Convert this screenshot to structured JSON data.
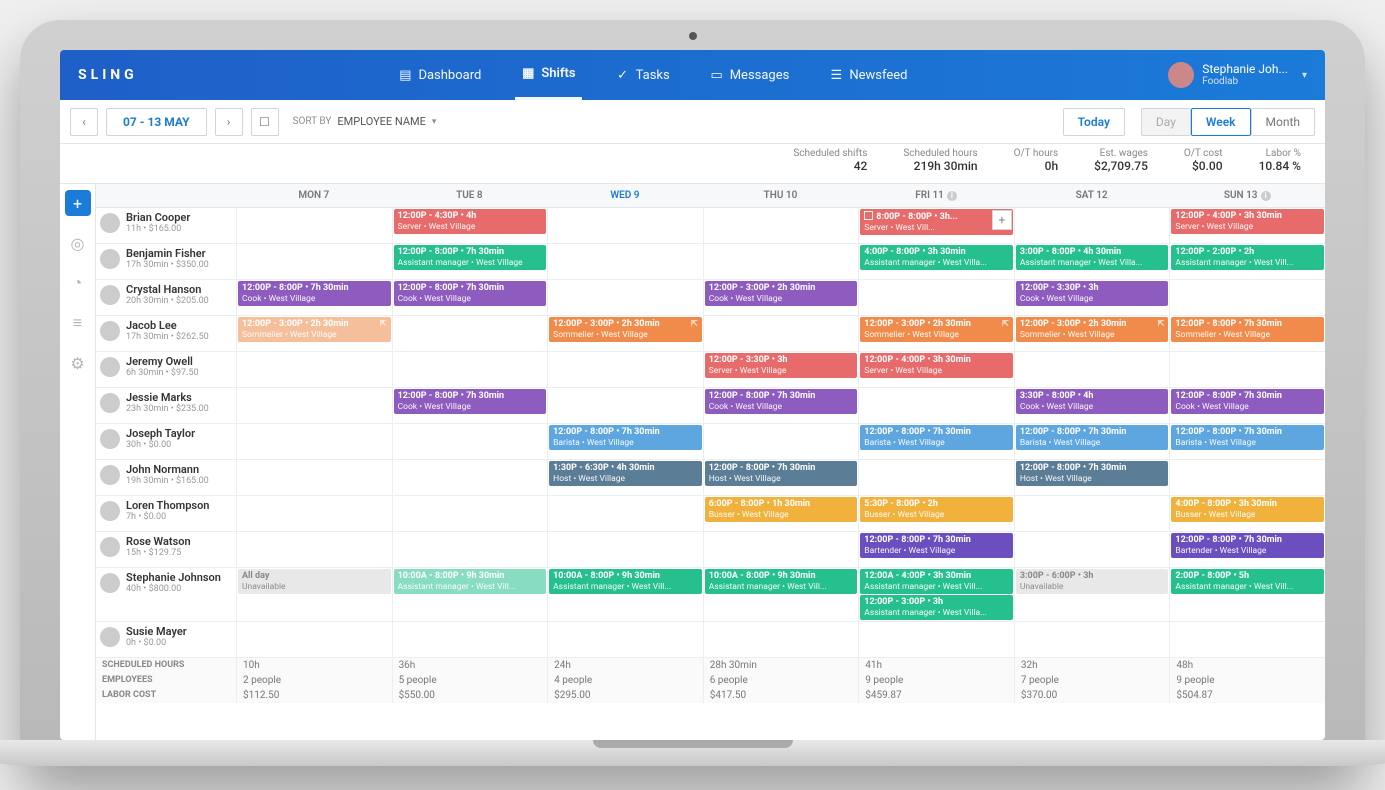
{
  "brand": "SLING",
  "nav": [
    {
      "label": "Dashboard",
      "icon": "dashboard"
    },
    {
      "label": "Shifts",
      "icon": "shifts",
      "active": true
    },
    {
      "label": "Tasks",
      "icon": "tasks"
    },
    {
      "label": "Messages",
      "icon": "messages"
    },
    {
      "label": "Newsfeed",
      "icon": "newsfeed"
    }
  ],
  "user": {
    "name": "Stephanie Joh...",
    "company": "Foodlab"
  },
  "toolbar": {
    "prev": "‹",
    "next": "›",
    "date_range": "07 - 13 MAY",
    "sort_label": "SORT BY",
    "sort_value": "EMPLOYEE NAME",
    "today": "Today",
    "views": [
      {
        "label": "Day",
        "state": "disabled"
      },
      {
        "label": "Week",
        "state": "active"
      },
      {
        "label": "Month",
        "state": ""
      }
    ]
  },
  "stats": [
    {
      "label": "Scheduled shifts",
      "value": "42"
    },
    {
      "label": "Scheduled hours",
      "value": "219h 30min"
    },
    {
      "label": "O/T hours",
      "value": "0h"
    },
    {
      "label": "Est. wages",
      "value": "$2,709.75"
    },
    {
      "label": "O/T cost",
      "value": "$0.00"
    },
    {
      "label": "Labor %",
      "value": "10.84 %"
    }
  ],
  "days": [
    {
      "label": "MON 7"
    },
    {
      "label": "TUE 8"
    },
    {
      "label": "WED 9",
      "active": true
    },
    {
      "label": "THU 10"
    },
    {
      "label": "FRI 11",
      "info": true
    },
    {
      "label": "SAT 12"
    },
    {
      "label": "SUN 13",
      "info": true
    }
  ],
  "colors": {
    "Server": "c-server",
    "Assistant manager": "c-am",
    "Cook": "c-cook",
    "Sommelier": "c-somm",
    "Barista": "c-barista",
    "Host": "c-host",
    "Busser": "c-busser",
    "Bartender": "c-bartender"
  },
  "employees": [
    {
      "name": "Brian Cooper",
      "meta": "11h • $165.00",
      "shifts": {
        "1": [
          {
            "time": "12:00P - 4:30P • 4h",
            "role": "Server",
            "loc": "West Village"
          }
        ],
        "4": [
          {
            "time": "8:00P - 8:00P • 3h...",
            "role": "Server",
            "loc": "West Vill...",
            "chk": true,
            "addplus": true
          }
        ],
        "6": [
          {
            "time": "12:00P - 4:00P • 3h 30min",
            "role": "Server",
            "loc": "West Village"
          }
        ]
      }
    },
    {
      "name": "Benjamin Fisher",
      "meta": "17h 30min • $350.00",
      "shifts": {
        "1": [
          {
            "time": "12:00P - 8:00P • 7h 30min",
            "role": "Assistant manager",
            "loc": "West Village"
          }
        ],
        "4": [
          {
            "time": "4:00P - 8:00P • 3h 30min",
            "role": "Assistant manager",
            "loc": "West Villa..."
          }
        ],
        "5": [
          {
            "time": "3:00P - 8:00P • 4h 30min",
            "role": "Assistant manager",
            "loc": "West Villa..."
          }
        ],
        "6": [
          {
            "time": "12:00P - 2:00P • 2h",
            "role": "Assistant manager",
            "loc": "West Vill..."
          }
        ]
      }
    },
    {
      "name": "Crystal Hanson",
      "meta": "20h 30min • $205.00",
      "shifts": {
        "0": [
          {
            "time": "12:00P - 8:00P • 7h 30min",
            "role": "Cook",
            "loc": "West Village"
          }
        ],
        "1": [
          {
            "time": "12:00P - 8:00P • 7h 30min",
            "role": "Cook",
            "loc": "West Village"
          }
        ],
        "3": [
          {
            "time": "12:00P - 3:00P • 2h 30min",
            "role": "Cook",
            "loc": "West Village"
          }
        ],
        "5": [
          {
            "time": "12:00P - 3:30P • 3h",
            "role": "Cook",
            "loc": "West Village"
          }
        ]
      }
    },
    {
      "name": "Jacob Lee",
      "meta": "17h 30min • $262.50",
      "shifts": {
        "0": [
          {
            "time": "12:00P - 3:00P • 2h 30min",
            "role": "Sommelier",
            "loc": "West Village",
            "faded": true,
            "ext": true
          }
        ],
        "2": [
          {
            "time": "12:00P - 3:00P • 2h 30min",
            "role": "Sommelier",
            "loc": "West Village",
            "ext": true
          }
        ],
        "4": [
          {
            "time": "12:00P - 3:00P • 2h 30min",
            "role": "Sommelier",
            "loc": "West Village",
            "ext": true
          }
        ],
        "5": [
          {
            "time": "12:00P - 3:00P • 2h 30min",
            "role": "Sommelier",
            "loc": "West Village",
            "ext": true
          }
        ],
        "6": [
          {
            "time": "12:00P - 8:00P • 7h 30min",
            "role": "Sommelier",
            "loc": "West Village"
          }
        ]
      }
    },
    {
      "name": "Jeremy Owell",
      "meta": "6h 30min • $97.50",
      "shifts": {
        "3": [
          {
            "time": "12:00P - 3:30P • 3h",
            "role": "Server",
            "loc": "West Village"
          }
        ],
        "4": [
          {
            "time": "12:00P - 4:00P • 3h 30min",
            "role": "Server",
            "loc": "West Village"
          }
        ]
      }
    },
    {
      "name": "Jessie Marks",
      "meta": "23h 30min • $235.00",
      "shifts": {
        "1": [
          {
            "time": "12:00P - 8:00P • 7h 30min",
            "role": "Cook",
            "loc": "West Village"
          }
        ],
        "3": [
          {
            "time": "12:00P - 8:00P • 7h 30min",
            "role": "Cook",
            "loc": "West Village"
          }
        ],
        "5": [
          {
            "time": "3:30P - 8:00P • 4h",
            "role": "Cook",
            "loc": "West Village"
          }
        ],
        "6": [
          {
            "time": "12:00P - 8:00P • 7h 30min",
            "role": "Cook",
            "loc": "West Village"
          }
        ]
      }
    },
    {
      "name": "Joseph Taylor",
      "meta": "30h • $0.00",
      "shifts": {
        "2": [
          {
            "time": "12:00P - 8:00P • 7h 30min",
            "role": "Barista",
            "loc": "West Village"
          }
        ],
        "4": [
          {
            "time": "12:00P - 8:00P • 7h 30min",
            "role": "Barista",
            "loc": "West Village"
          }
        ],
        "5": [
          {
            "time": "12:00P - 8:00P • 7h 30min",
            "role": "Barista",
            "loc": "West Village"
          }
        ],
        "6": [
          {
            "time": "12:00P - 8:00P • 7h 30min",
            "role": "Barista",
            "loc": "West Village"
          }
        ]
      }
    },
    {
      "name": "John Normann",
      "meta": "19h 30min • $165.00",
      "shifts": {
        "2": [
          {
            "time": "1:30P - 6:30P • 4h 30min",
            "role": "Host",
            "loc": "West Village"
          }
        ],
        "3": [
          {
            "time": "12:00P - 8:00P • 7h 30min",
            "role": "Host",
            "loc": "West Village"
          }
        ],
        "5": [
          {
            "time": "12:00P - 8:00P • 7h 30min",
            "role": "Host",
            "loc": "West Village"
          }
        ]
      }
    },
    {
      "name": "Loren Thompson",
      "meta": "7h • $0.00",
      "shifts": {
        "3": [
          {
            "time": "6:00P - 8:00P • 1h 30min",
            "role": "Busser",
            "loc": "West Village"
          }
        ],
        "4": [
          {
            "time": "5:30P - 8:00P • 2h",
            "role": "Busser",
            "loc": "West Village"
          }
        ],
        "6": [
          {
            "time": "4:00P - 8:00P • 3h 30min",
            "role": "Busser",
            "loc": "West Village"
          }
        ]
      }
    },
    {
      "name": "Rose Watson",
      "meta": "15h • $129.75",
      "shifts": {
        "4": [
          {
            "time": "12:00P - 8:00P • 7h 30min",
            "role": "Bartender",
            "loc": "West Village"
          }
        ],
        "6": [
          {
            "time": "12:00P - 8:00P • 7h 30min",
            "role": "Bartender",
            "loc": "West Village"
          }
        ]
      }
    },
    {
      "name": "Stephanie Johnson",
      "meta": "40h • $800.00",
      "shifts": {
        "0": [
          {
            "time": "All day",
            "role": "Unavailable",
            "unavail": true
          }
        ],
        "1": [
          {
            "time": "10:00A - 8:00P • 9h 30min",
            "role": "Assistant manager",
            "loc": "West Vill...",
            "faded": true
          }
        ],
        "2": [
          {
            "time": "10:00A - 8:00P • 9h 30min",
            "role": "Assistant manager",
            "loc": "West Vill..."
          }
        ],
        "3": [
          {
            "time": "10:00A - 8:00P • 9h 30min",
            "role": "Assistant manager",
            "loc": "West Vill..."
          }
        ],
        "4": [
          {
            "time": "12:00A - 4:00P • 3h 30min",
            "role": "Assistant manager",
            "loc": "West Vill..."
          },
          {
            "time": "12:00P - 3:00P • 3h",
            "role": "Assistant manager",
            "loc": "West Villa..."
          }
        ],
        "5": [
          {
            "time": "3:00P - 6:00P • 3h",
            "role": "Unavailable",
            "unavail": true
          }
        ],
        "6": [
          {
            "time": "2:00P - 8:00P • 5h",
            "role": "Assistant manager",
            "loc": "West Vill..."
          }
        ]
      }
    },
    {
      "name": "Susie Mayer",
      "meta": "0h • $0.00",
      "shifts": {}
    }
  ],
  "footer": {
    "rows": [
      {
        "label": "SCHEDULED HOURS",
        "cells": [
          "10h",
          "36h",
          "24h",
          "28h 30min",
          "41h",
          "32h",
          "48h"
        ]
      },
      {
        "label": "EMPLOYEES",
        "cells": [
          "2 people",
          "5 people",
          "4 people",
          "6 people",
          "9 people",
          "7 people",
          "9 people"
        ]
      },
      {
        "label": "LABOR COST",
        "cells": [
          "$112.50",
          "$550.00",
          "$295.00",
          "$417.50",
          "$459.87",
          "$370.00",
          "$504.87"
        ]
      }
    ]
  },
  "side_icons": [
    "plus",
    "pin",
    "clock",
    "list",
    "settings"
  ]
}
